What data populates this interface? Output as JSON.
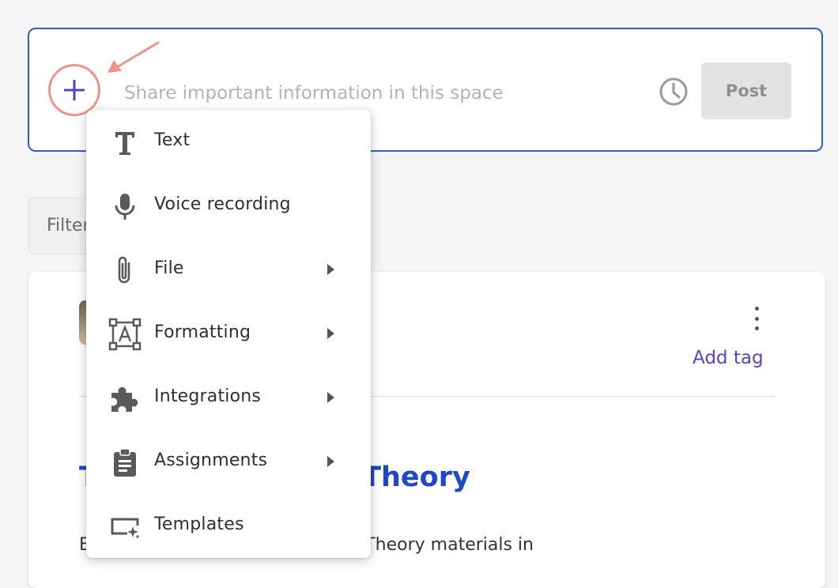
{
  "composer": {
    "placeholder": "Share important information in this space",
    "post_label": "Post",
    "icons": {
      "add": "plus-icon",
      "schedule": "clock-icon"
    },
    "colors": {
      "border": "#2c5fc4",
      "plus": "#5b3fc4",
      "highlight": "#f0938a"
    }
  },
  "filter": {
    "label": "Filter"
  },
  "post_card": {
    "add_tag_label": "Add tag",
    "title": "Topics: Consumer Theory",
    "body": "Be sure to review the Consumer Theory materials in"
  },
  "insert_menu": {
    "items": [
      {
        "label": "Text",
        "icon": "text-icon",
        "has_submenu": false
      },
      {
        "label": "Voice recording",
        "icon": "microphone-icon",
        "has_submenu": false
      },
      {
        "label": "File",
        "icon": "paperclip-icon",
        "has_submenu": true
      },
      {
        "label": "Formatting",
        "icon": "formatting-icon",
        "has_submenu": true
      },
      {
        "label": "Integrations",
        "icon": "puzzle-icon",
        "has_submenu": true
      },
      {
        "label": "Assignments",
        "icon": "clipboard-icon",
        "has_submenu": true
      },
      {
        "label": "Templates",
        "icon": "templates-icon",
        "has_submenu": false
      }
    ]
  }
}
